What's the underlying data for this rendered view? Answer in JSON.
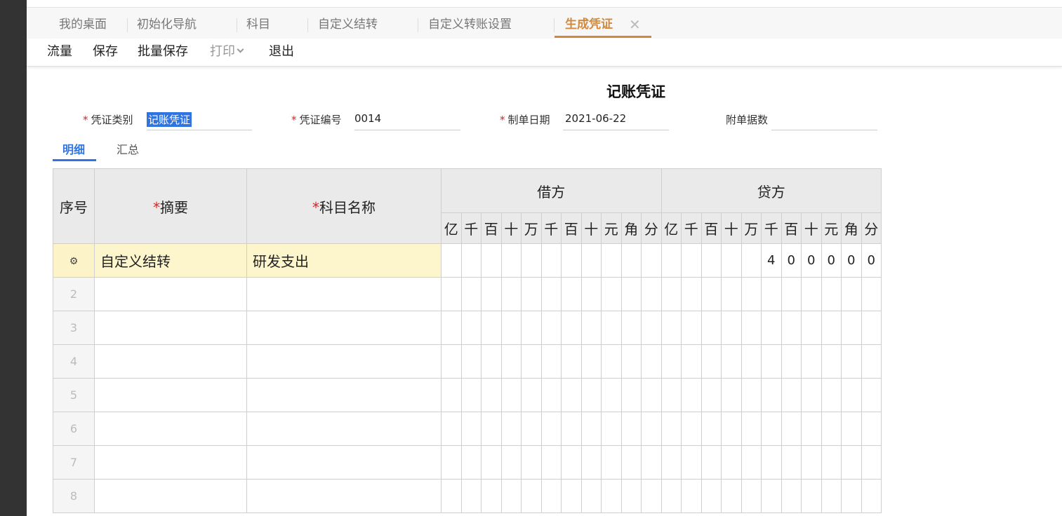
{
  "tabs": [
    {
      "label": "我的桌面"
    },
    {
      "label": "初始化导航"
    },
    {
      "label": "科目"
    },
    {
      "label": "自定义结转"
    },
    {
      "label": "自定义转账设置"
    },
    {
      "label": "生成凭证",
      "active": true
    }
  ],
  "toolbar": {
    "flow": "流量",
    "save": "保存",
    "batch_save": "批量保存",
    "print": "打印",
    "exit": "退出"
  },
  "voucher": {
    "title": "记账凭证",
    "type_label": "凭证类别",
    "type_value": "记账凭证",
    "number_label": "凭证编号",
    "number_value": "0014",
    "date_label": "制单日期",
    "date_value": "2021-06-22",
    "attach_label": "附单据数",
    "attach_value": ""
  },
  "subtabs": {
    "detail": "明细",
    "summary": "汇总"
  },
  "table": {
    "col_no": "序号",
    "col_summary": "摘要",
    "col_account": "科目名称",
    "debit": "借方",
    "credit": "贷方",
    "digits": [
      "亿",
      "千",
      "百",
      "十",
      "万",
      "千",
      "百",
      "十",
      "元",
      "角",
      "分"
    ],
    "rows": [
      {
        "no": "",
        "summary": "自定义结转",
        "account": "研发支出",
        "debit": [
          "",
          "",
          "",
          "",
          "",
          "",
          "",
          "",
          "",
          "",
          ""
        ],
        "credit": [
          "",
          "",
          "",
          "",
          "",
          "4",
          "0",
          "0",
          "0",
          "0",
          "0"
        ]
      },
      {
        "no": "2",
        "summary": "",
        "account": "",
        "debit": [
          "",
          "",
          "",
          "",
          "",
          "",
          "",
          "",
          "",
          "",
          ""
        ],
        "credit": [
          "",
          "",
          "",
          "",
          "",
          "",
          "",
          "",
          "",
          "",
          ""
        ]
      },
      {
        "no": "3",
        "summary": "",
        "account": "",
        "debit": [
          "",
          "",
          "",
          "",
          "",
          "",
          "",
          "",
          "",
          "",
          ""
        ],
        "credit": [
          "",
          "",
          "",
          "",
          "",
          "",
          "",
          "",
          "",
          "",
          ""
        ]
      },
      {
        "no": "4",
        "summary": "",
        "account": "",
        "debit": [
          "",
          "",
          "",
          "",
          "",
          "",
          "",
          "",
          "",
          "",
          ""
        ],
        "credit": [
          "",
          "",
          "",
          "",
          "",
          "",
          "",
          "",
          "",
          "",
          ""
        ]
      },
      {
        "no": "5",
        "summary": "",
        "account": "",
        "debit": [
          "",
          "",
          "",
          "",
          "",
          "",
          "",
          "",
          "",
          "",
          ""
        ],
        "credit": [
          "",
          "",
          "",
          "",
          "",
          "",
          "",
          "",
          "",
          "",
          ""
        ]
      },
      {
        "no": "6",
        "summary": "",
        "account": "",
        "debit": [
          "",
          "",
          "",
          "",
          "",
          "",
          "",
          "",
          "",
          "",
          ""
        ],
        "credit": [
          "",
          "",
          "",
          "",
          "",
          "",
          "",
          "",
          "",
          "",
          ""
        ]
      },
      {
        "no": "7",
        "summary": "",
        "account": "",
        "debit": [
          "",
          "",
          "",
          "",
          "",
          "",
          "",
          "",
          "",
          "",
          ""
        ],
        "credit": [
          "",
          "",
          "",
          "",
          "",
          "",
          "",
          "",
          "",
          "",
          ""
        ]
      },
      {
        "no": "8",
        "summary": "",
        "account": "",
        "debit": [
          "",
          "",
          "",
          "",
          "",
          "",
          "",
          "",
          "",
          "",
          ""
        ],
        "credit": [
          "",
          "",
          "",
          "",
          "",
          "",
          "",
          "",
          "",
          "",
          ""
        ]
      }
    ]
  },
  "colors": {
    "active_tab": "#d08a3e",
    "accent": "#2f74e0",
    "required": "#e02020",
    "row_highlight": "#fdf5cc"
  }
}
